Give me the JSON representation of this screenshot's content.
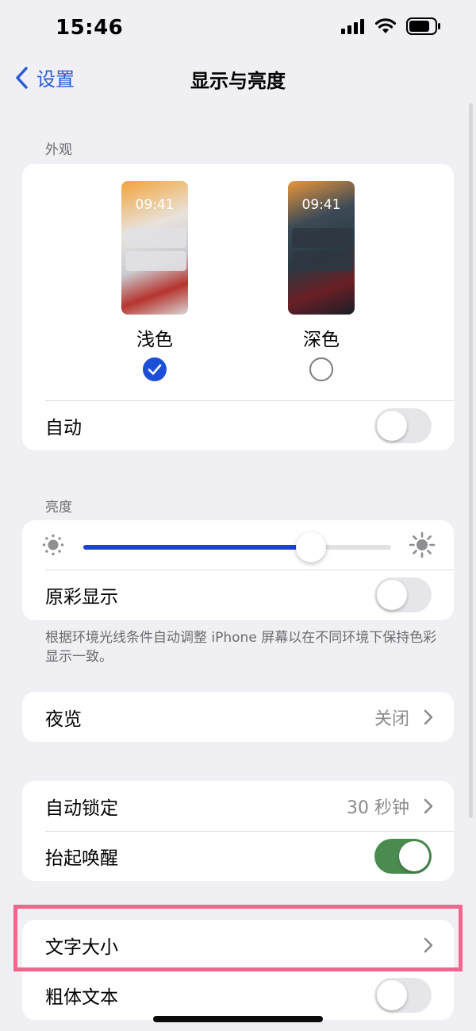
{
  "status_bar": {
    "time": "15:46"
  },
  "nav": {
    "back_label": "设置",
    "title": "显示与亮度"
  },
  "appearance": {
    "header": "外观",
    "light": {
      "time": "09:41",
      "label": "浅色",
      "selected": true
    },
    "dark": {
      "time": "09:41",
      "label": "深色",
      "selected": false
    },
    "auto_label": "自动",
    "auto_on": false
  },
  "brightness": {
    "header": "亮度",
    "level": 0.74,
    "true_tone_label": "原彩显示",
    "true_tone_on": false,
    "footer": "根据环境光线条件自动调整 iPhone 屏幕以在不同环境下保持色彩显示一致。"
  },
  "night_shift": {
    "label": "夜览",
    "value": "关闭"
  },
  "lock": {
    "auto_lock_label": "自动锁定",
    "auto_lock_value": "30 秒钟",
    "raise_to_wake_label": "抬起唤醒",
    "raise_to_wake_on": true
  },
  "text": {
    "text_size_label": "文字大小",
    "bold_text_label": "粗体文本",
    "bold_text_on": false
  },
  "colors": {
    "accent": "#1c43cf",
    "toggle_on": "#4a8c4f",
    "highlight": "#f2668e"
  }
}
